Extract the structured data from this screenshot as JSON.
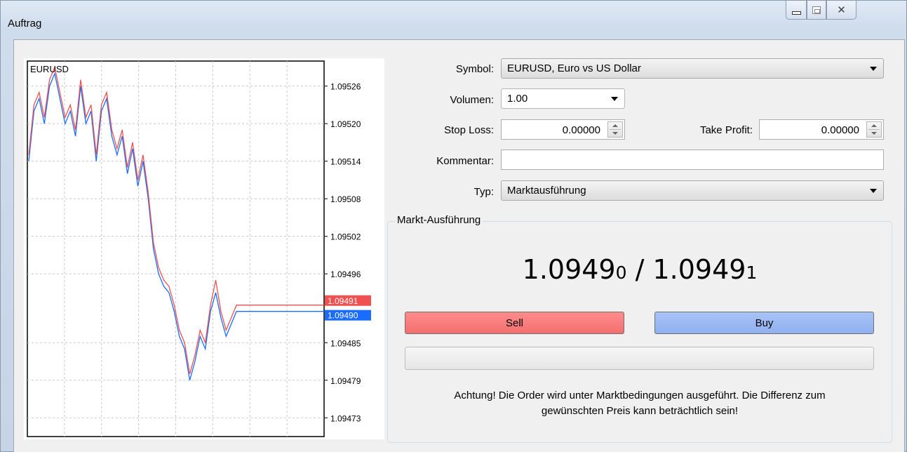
{
  "window": {
    "title": "Auftrag"
  },
  "chart": {
    "symbol": "EURUSD",
    "y_ticks": [
      "1.09526",
      "1.09520",
      "1.09514",
      "1.09508",
      "1.09502",
      "1.09496",
      "1.09491",
      "1.09490",
      "1.09485",
      "1.09479",
      "1.09473"
    ],
    "ask_label": "1.09491",
    "bid_label": "1.09490",
    "ask_color": "#f05050",
    "bid_color": "#1a6cff"
  },
  "chart_data": {
    "type": "line",
    "title": "EURUSD",
    "ylim": [
      1.0947,
      1.0953
    ],
    "series": [
      {
        "values": [
          1.09514,
          1.09522,
          1.09524,
          1.0952,
          1.09526,
          1.09528,
          1.09524,
          1.0952,
          1.09522,
          1.09518,
          1.09526,
          1.0952,
          1.09522,
          1.09514,
          1.09522,
          1.09524,
          1.09518,
          1.09515,
          1.09518,
          1.09512,
          1.09516,
          1.0951,
          1.09514,
          1.09508,
          1.095,
          1.09496,
          1.09494,
          1.09493,
          1.0949,
          1.09486,
          1.09484,
          1.09479,
          1.09482,
          1.09486,
          1.09484,
          1.0949,
          1.09493,
          1.09489,
          1.09486,
          1.09488,
          1.0949,
          1.0949,
          1.0949,
          1.0949,
          1.0949
        ]
      },
      {
        "values": [
          1.09515,
          1.09523,
          1.09525,
          1.09521,
          1.09527,
          1.09529,
          1.09525,
          1.09521,
          1.09523,
          1.09519,
          1.09527,
          1.09521,
          1.09523,
          1.09515,
          1.09523,
          1.09525,
          1.09519,
          1.09516,
          1.09519,
          1.09513,
          1.09517,
          1.09511,
          1.09515,
          1.09509,
          1.09501,
          1.09497,
          1.09495,
          1.09494,
          1.09491,
          1.09487,
          1.09485,
          1.0948,
          1.09483,
          1.09487,
          1.09485,
          1.09491,
          1.09495,
          1.0949,
          1.09487,
          1.09489,
          1.09491,
          1.09491,
          1.09491,
          1.09491,
          1.09491
        ]
      }
    ]
  },
  "form": {
    "symbol_label": "Symbol:",
    "symbol_value": "EURUSD, Euro vs US Dollar",
    "volume_label": "Volumen:",
    "volume_value": "1.00",
    "stoploss_label": "Stop Loss:",
    "stoploss_value": "0.00000",
    "takeprofit_label": "Take Profit:",
    "takeprofit_value": "0.00000",
    "comment_label": "Kommentar:",
    "comment_value": "",
    "type_label": "Typ:",
    "type_value": "Marktausführung"
  },
  "market": {
    "group_title": "Markt-Ausführung",
    "bid_main": "1.0949",
    "bid_small": "0",
    "separator": " / ",
    "ask_main": "1.0949",
    "ask_small": "1",
    "sell_label": "Sell",
    "buy_label": "Buy",
    "warning_line1": "Achtung! Die Order wird unter Marktbedingungen ausgeführt. Die Differenz zum",
    "warning_line2": "gewünschten Preis kann beträchtlich sein!"
  }
}
